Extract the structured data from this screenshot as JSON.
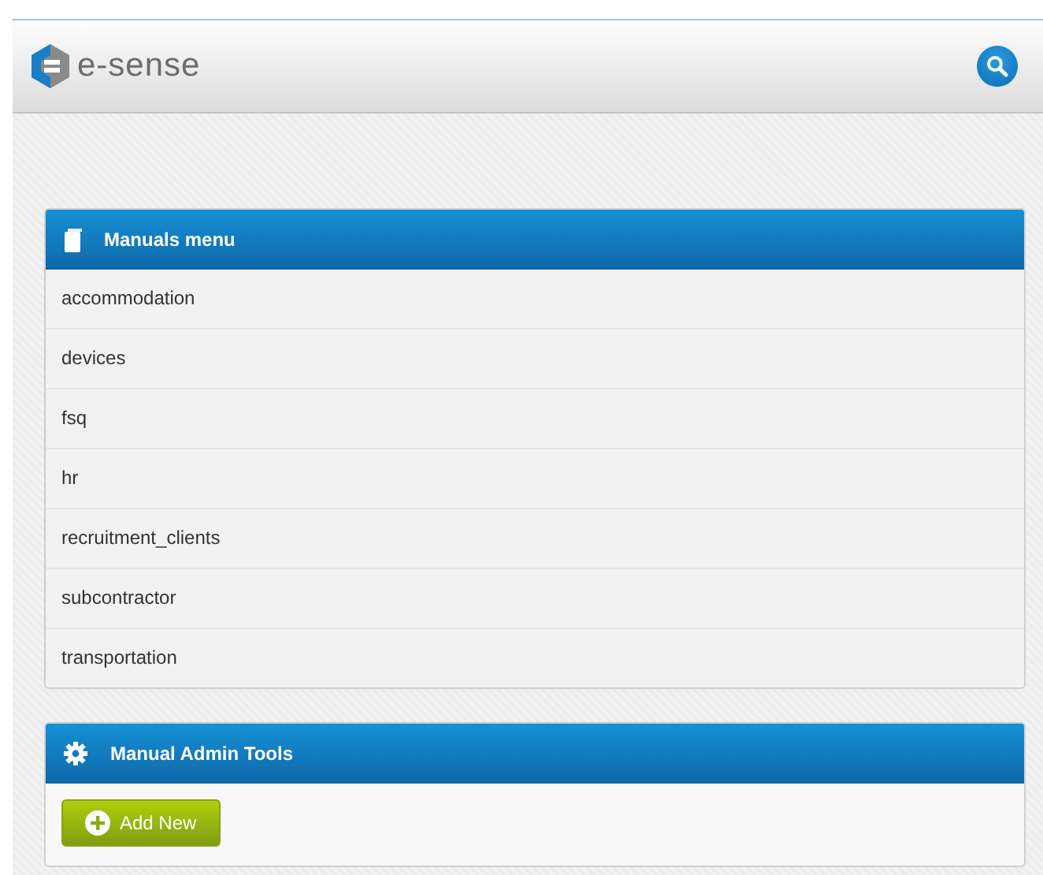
{
  "header": {
    "logo_text": "e-sense"
  },
  "manuals_menu": {
    "title": "Manuals menu",
    "items": [
      {
        "label": "accommodation"
      },
      {
        "label": "devices"
      },
      {
        "label": "fsq"
      },
      {
        "label": "hr"
      },
      {
        "label": "recruitment_clients"
      },
      {
        "label": "subcontractor"
      },
      {
        "label": "transportation"
      }
    ]
  },
  "admin_tools": {
    "title": "Manual Admin Tools",
    "buttons": [
      {
        "label": "Add New",
        "kind": "add"
      }
    ]
  }
}
